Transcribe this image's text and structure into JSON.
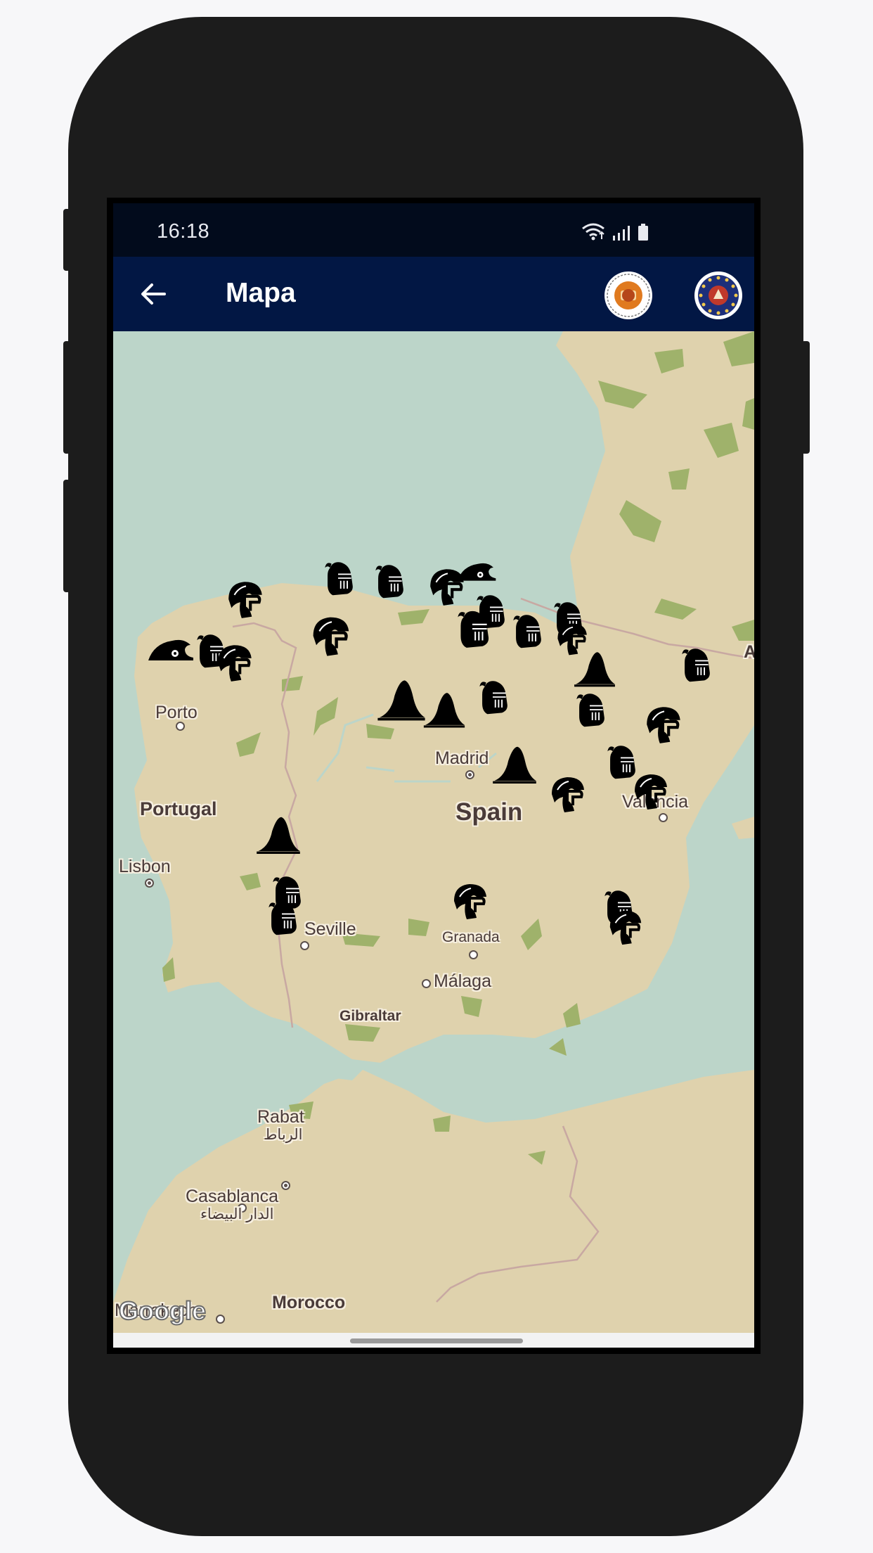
{
  "status_bar": {
    "time": "16:18",
    "icons": [
      "wifi-icon",
      "signal-icon",
      "battery-icon"
    ]
  },
  "app_bar": {
    "title": "Mapa",
    "back_icon": "arrow-left-icon",
    "logos": [
      "association-logo",
      "european-circle-logo"
    ]
  },
  "map": {
    "provider": "Google",
    "labels": {
      "porto": "Porto",
      "portugal": "Portugal",
      "lisbon": "Lisbon",
      "madrid": "Madrid",
      "spain": "Spain",
      "valencia": "Valencia",
      "seville": "Seville",
      "granada": "Granada",
      "malaga": "Málaga",
      "gibraltar": "Gibraltar",
      "rabat": "Rabat",
      "rabat_ar": "الرباط",
      "casablanca": "Casablanca",
      "casablanca_ar": "الدار البيضاء",
      "morocco": "Morocco",
      "marrakech_partial": "Marrakech",
      "andorra_partial": "A"
    },
    "marker_types": [
      "knight-helmet-icon",
      "roman-helmet-icon",
      "phrygian-cap-icon",
      "hat-icon"
    ],
    "colors": {
      "water": "#bcd5c9",
      "land": "#dfd2ad",
      "vegetation": "#9fb26b",
      "appbar": "#021744",
      "statusbar": "#020b1c"
    }
  }
}
